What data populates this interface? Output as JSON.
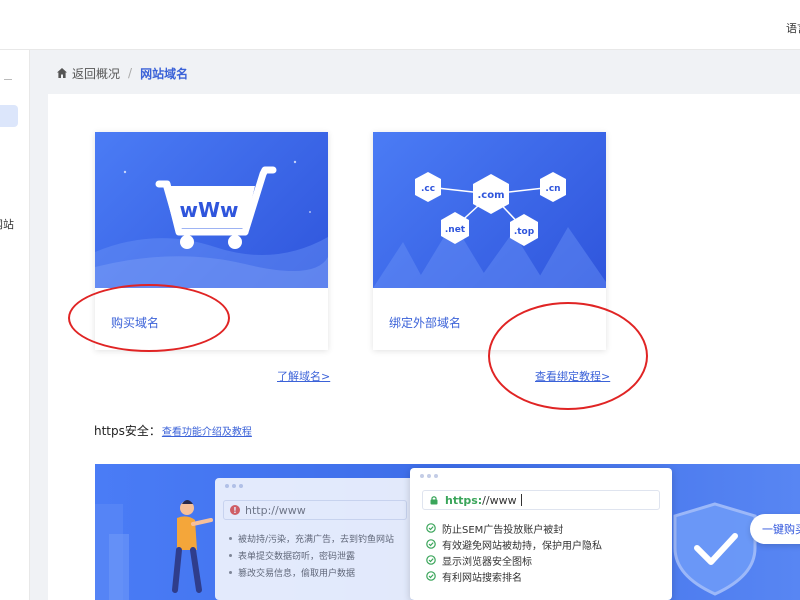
{
  "header": {
    "language_label": "语言"
  },
  "sidebar": {
    "site_label_fragment": "网站"
  },
  "breadcrumb": {
    "back_label": "返回概况",
    "separator": "/",
    "current_label": "网站域名"
  },
  "cards": {
    "buy": {
      "label": "购买域名",
      "banner_text": "wWw"
    },
    "bind": {
      "label": "绑定外部域名",
      "domain_bubbles": [
        ".cc",
        ".com",
        ".cn",
        ".net",
        ".top"
      ]
    }
  },
  "links": {
    "learn_domain": "了解域名>",
    "bind_tutorial": "查看绑定教程>"
  },
  "https_section": {
    "label": "https安全：",
    "link": "查看功能介绍及教程"
  },
  "https_banner": {
    "http_address": "http://www",
    "https_scheme": "https:",
    "https_rest": "//www",
    "http_risks": [
      "被劫持/污染，充满广告，去到钓鱼网站",
      "表单提交数据窃听，密码泄露",
      "篡改交易信息，偷取用户数据"
    ],
    "https_benefits": [
      "防止SEM广告投放账户被封",
      "有效避免网站被劫持，保护用户隐私",
      "显示浏览器安全图标",
      "有利网站搜索排名"
    ],
    "cta_label": "一键购买"
  },
  "colors": {
    "brand_blue": "#3b62d8",
    "banner_blue": "#4a7cf6",
    "check_green": "#3aa55a",
    "annotation_red": "#e02424"
  },
  "icons": [
    "home-icon",
    "cart-icon",
    "lock-icon",
    "check-circle-icon",
    "shield-icon",
    "warning-icon"
  ]
}
